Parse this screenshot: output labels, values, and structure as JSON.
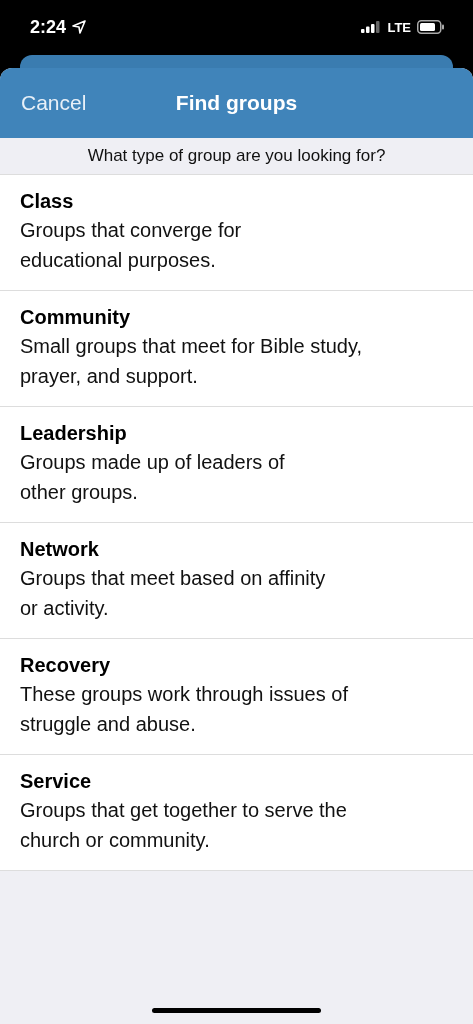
{
  "status_bar": {
    "time": "2:24",
    "network": "LTE"
  },
  "nav_bar": {
    "cancel": "Cancel",
    "title": "Find groups"
  },
  "prompt": "What type of group are you looking for?",
  "group_types": [
    {
      "name": "Class",
      "description": "Groups that converge for\neducational purposes."
    },
    {
      "name": "Community",
      "description": "Small groups that meet for Bible study,\nprayer, and support."
    },
    {
      "name": "Leadership",
      "description": "Groups made up of leaders of\nother groups."
    },
    {
      "name": "Network",
      "description": "Groups that meet based on affinity\nor activity."
    },
    {
      "name": "Recovery",
      "description": "These groups work through issues of\nstruggle and abuse."
    },
    {
      "name": "Service",
      "description": "Groups that get together to serve the\nchurch or community."
    }
  ]
}
